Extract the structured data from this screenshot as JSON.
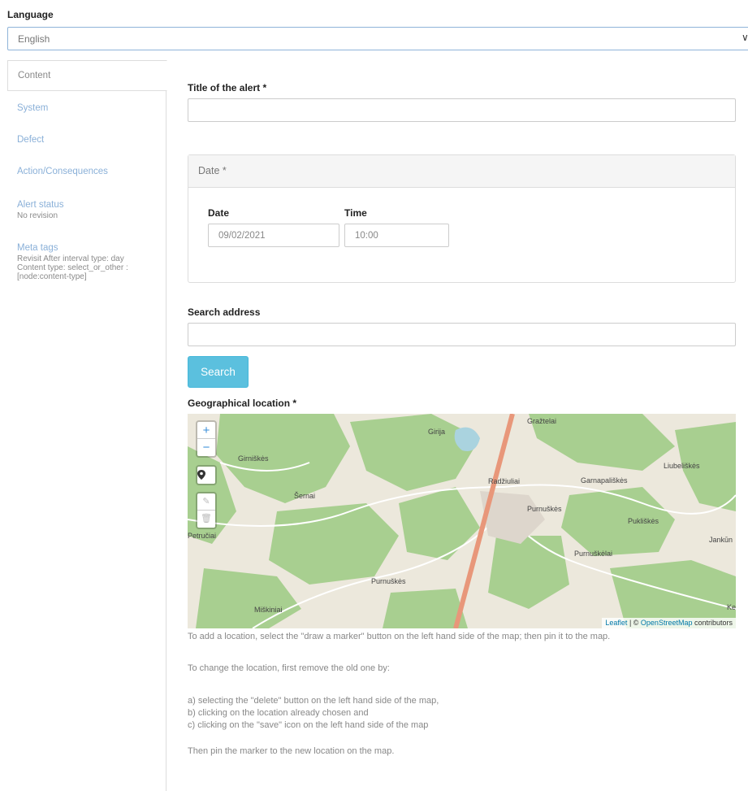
{
  "language": {
    "label": "Language",
    "value": "English"
  },
  "tabs": [
    {
      "label": "Content",
      "summary": ""
    },
    {
      "label": "System",
      "summary": ""
    },
    {
      "label": "Defect",
      "summary": ""
    },
    {
      "label": "Action/Consequences",
      "summary": ""
    },
    {
      "label": "Alert status",
      "summary": "No revision"
    },
    {
      "label": "Meta tags",
      "summary": "Revisit After interval type: day Content type: select_or_other : [node:content-type]"
    }
  ],
  "form": {
    "title_label": "Title of the alert *",
    "title_value": "",
    "date_panel": {
      "heading": "Date *",
      "date_label": "Date",
      "date_value": "09/02/2021",
      "time_label": "Time",
      "time_value": "10:00"
    },
    "search_label": "Search address",
    "search_value": "",
    "search_button": "Search",
    "geo_label": "Geographical location *"
  },
  "map": {
    "zoom_in": "+",
    "zoom_out": "−",
    "places": [
      "Gražtelai",
      "Girija",
      "Girniškės",
      "Liubeliškės",
      "Radžiuliai",
      "Garnapališkės",
      "Šernai",
      "Purnuškės",
      "Pukliškės",
      "Petručiai",
      "Jankūn",
      "Purnuškėlai",
      "Purnuškės",
      "Miškiniai",
      "Ke"
    ],
    "attribution_leaflet": "Leaflet",
    "attribution_sep": " | © ",
    "attribution_osm": "OpenStreetMap",
    "attribution_tail": " contributors"
  },
  "help": {
    "add": "To add a location, select the \"draw a marker\" button on the left hand side of the map; then pin it to the map.",
    "change": "To change the location, first remove the old one by:",
    "step_a": "a) selecting the \"delete\" button on the left hand side of the map,",
    "step_b": "b) clicking on the location already chosen and",
    "step_c": "c) clicking on the \"save\" icon on the left hand side of the map",
    "then": "Then pin the marker to the new location on the map."
  },
  "colors": {
    "link": "#8ab0d8",
    "search_button": "#5bc0de",
    "forest": "#a8cf90",
    "road": "#e8977a"
  }
}
